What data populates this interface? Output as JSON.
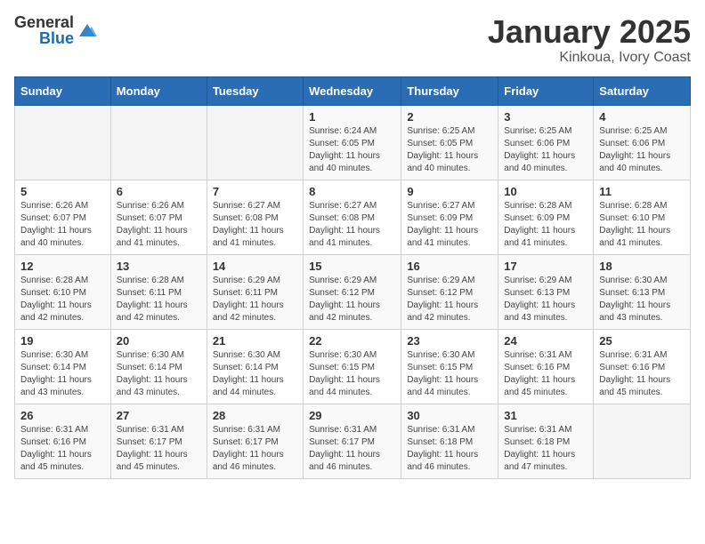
{
  "logo": {
    "general": "General",
    "blue": "Blue"
  },
  "title": "January 2025",
  "subtitle": "Kinkoua, Ivory Coast",
  "days_of_week": [
    "Sunday",
    "Monday",
    "Tuesday",
    "Wednesday",
    "Thursday",
    "Friday",
    "Saturday"
  ],
  "weeks": [
    [
      {
        "day": "",
        "info": ""
      },
      {
        "day": "",
        "info": ""
      },
      {
        "day": "",
        "info": ""
      },
      {
        "day": "1",
        "info": "Sunrise: 6:24 AM\nSunset: 6:05 PM\nDaylight: 11 hours and 40 minutes."
      },
      {
        "day": "2",
        "info": "Sunrise: 6:25 AM\nSunset: 6:05 PM\nDaylight: 11 hours and 40 minutes."
      },
      {
        "day": "3",
        "info": "Sunrise: 6:25 AM\nSunset: 6:06 PM\nDaylight: 11 hours and 40 minutes."
      },
      {
        "day": "4",
        "info": "Sunrise: 6:25 AM\nSunset: 6:06 PM\nDaylight: 11 hours and 40 minutes."
      }
    ],
    [
      {
        "day": "5",
        "info": "Sunrise: 6:26 AM\nSunset: 6:07 PM\nDaylight: 11 hours and 40 minutes."
      },
      {
        "day": "6",
        "info": "Sunrise: 6:26 AM\nSunset: 6:07 PM\nDaylight: 11 hours and 41 minutes."
      },
      {
        "day": "7",
        "info": "Sunrise: 6:27 AM\nSunset: 6:08 PM\nDaylight: 11 hours and 41 minutes."
      },
      {
        "day": "8",
        "info": "Sunrise: 6:27 AM\nSunset: 6:08 PM\nDaylight: 11 hours and 41 minutes."
      },
      {
        "day": "9",
        "info": "Sunrise: 6:27 AM\nSunset: 6:09 PM\nDaylight: 11 hours and 41 minutes."
      },
      {
        "day": "10",
        "info": "Sunrise: 6:28 AM\nSunset: 6:09 PM\nDaylight: 11 hours and 41 minutes."
      },
      {
        "day": "11",
        "info": "Sunrise: 6:28 AM\nSunset: 6:10 PM\nDaylight: 11 hours and 41 minutes."
      }
    ],
    [
      {
        "day": "12",
        "info": "Sunrise: 6:28 AM\nSunset: 6:10 PM\nDaylight: 11 hours and 42 minutes."
      },
      {
        "day": "13",
        "info": "Sunrise: 6:28 AM\nSunset: 6:11 PM\nDaylight: 11 hours and 42 minutes."
      },
      {
        "day": "14",
        "info": "Sunrise: 6:29 AM\nSunset: 6:11 PM\nDaylight: 11 hours and 42 minutes."
      },
      {
        "day": "15",
        "info": "Sunrise: 6:29 AM\nSunset: 6:12 PM\nDaylight: 11 hours and 42 minutes."
      },
      {
        "day": "16",
        "info": "Sunrise: 6:29 AM\nSunset: 6:12 PM\nDaylight: 11 hours and 42 minutes."
      },
      {
        "day": "17",
        "info": "Sunrise: 6:29 AM\nSunset: 6:13 PM\nDaylight: 11 hours and 43 minutes."
      },
      {
        "day": "18",
        "info": "Sunrise: 6:30 AM\nSunset: 6:13 PM\nDaylight: 11 hours and 43 minutes."
      }
    ],
    [
      {
        "day": "19",
        "info": "Sunrise: 6:30 AM\nSunset: 6:14 PM\nDaylight: 11 hours and 43 minutes."
      },
      {
        "day": "20",
        "info": "Sunrise: 6:30 AM\nSunset: 6:14 PM\nDaylight: 11 hours and 43 minutes."
      },
      {
        "day": "21",
        "info": "Sunrise: 6:30 AM\nSunset: 6:14 PM\nDaylight: 11 hours and 44 minutes."
      },
      {
        "day": "22",
        "info": "Sunrise: 6:30 AM\nSunset: 6:15 PM\nDaylight: 11 hours and 44 minutes."
      },
      {
        "day": "23",
        "info": "Sunrise: 6:30 AM\nSunset: 6:15 PM\nDaylight: 11 hours and 44 minutes."
      },
      {
        "day": "24",
        "info": "Sunrise: 6:31 AM\nSunset: 6:16 PM\nDaylight: 11 hours and 45 minutes."
      },
      {
        "day": "25",
        "info": "Sunrise: 6:31 AM\nSunset: 6:16 PM\nDaylight: 11 hours and 45 minutes."
      }
    ],
    [
      {
        "day": "26",
        "info": "Sunrise: 6:31 AM\nSunset: 6:16 PM\nDaylight: 11 hours and 45 minutes."
      },
      {
        "day": "27",
        "info": "Sunrise: 6:31 AM\nSunset: 6:17 PM\nDaylight: 11 hours and 45 minutes."
      },
      {
        "day": "28",
        "info": "Sunrise: 6:31 AM\nSunset: 6:17 PM\nDaylight: 11 hours and 46 minutes."
      },
      {
        "day": "29",
        "info": "Sunrise: 6:31 AM\nSunset: 6:17 PM\nDaylight: 11 hours and 46 minutes."
      },
      {
        "day": "30",
        "info": "Sunrise: 6:31 AM\nSunset: 6:18 PM\nDaylight: 11 hours and 46 minutes."
      },
      {
        "day": "31",
        "info": "Sunrise: 6:31 AM\nSunset: 6:18 PM\nDaylight: 11 hours and 47 minutes."
      },
      {
        "day": "",
        "info": ""
      }
    ]
  ]
}
